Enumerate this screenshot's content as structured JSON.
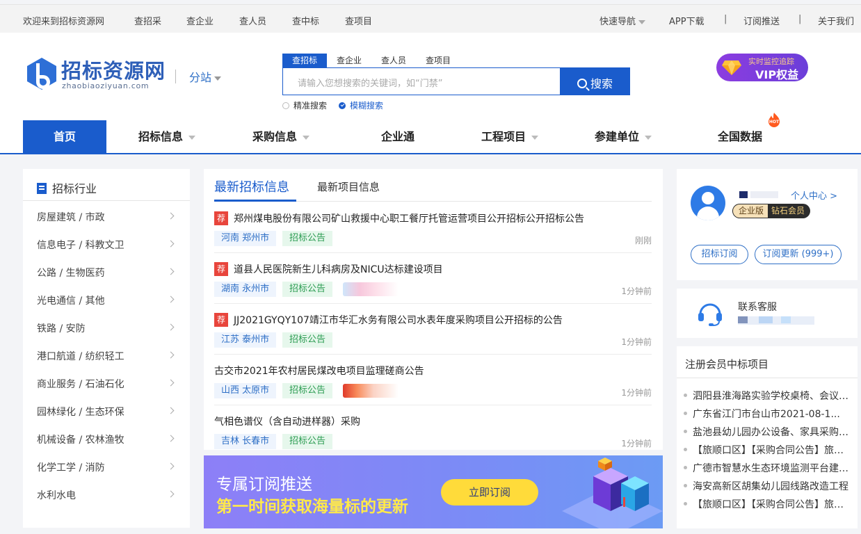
{
  "topbar": {
    "welcome": "欢迎来到招标资源网",
    "links": [
      "查招采",
      "查企业",
      "查人员",
      "查中标",
      "查项目"
    ],
    "quick_nav": "快速导航",
    "app_download": "APP下载",
    "subscribe_push": "订阅推送",
    "about_us": "关于我们",
    "separator": "|"
  },
  "header": {
    "logo_text": "招标资源网",
    "logo_domain": "zhaobiaoziyuan.com",
    "substation": "分站",
    "search_tabs": [
      "查招标",
      "查企业",
      "查人员",
      "查项目"
    ],
    "search_placeholder": "请输入您想搜索的关键词，如“门禁”",
    "search_button": "搜索",
    "search_options": [
      "精准搜索",
      "模糊搜索"
    ],
    "vip_small": "实时监控追踪",
    "vip_big": "VIP权益"
  },
  "nav": {
    "items": [
      "首页",
      "招标信息",
      "采购信息",
      "企业通",
      "工程项目",
      "参建单位",
      "全国数据"
    ],
    "hot_label": "HOT"
  },
  "sidebar": {
    "title": "招标行业",
    "items": [
      "房屋建筑 / 市政",
      "信息电子 / 科教文卫",
      "公路 / 生物医药",
      "光电通信 / 其他",
      "铁路 / 安防",
      "港口航道 / 纺织轻工",
      "商业服务 / 石油石化",
      "园林绿化 / 生态环保",
      "机械设备 / 农林渔牧",
      "化学工学 / 消防",
      "水利水电"
    ]
  },
  "center": {
    "tab_active": "最新招标信息",
    "tab_other": "最新项目信息",
    "rec_label": "荐",
    "rows": [
      {
        "title": "郑州煤电股份有限公司矿山救援中心职工餐厅托管运营项目公开招标公开招标公告",
        "location": "河南 郑州市",
        "type": "招标公告",
        "time": "刚刚"
      },
      {
        "title": "道县人民医院新生儿科病房及NICU达标建设项目",
        "location": "湖南 永州市",
        "type": "招标公告",
        "time": "1分钟前"
      },
      {
        "title": "JJ2021GYQY107靖江市华汇水务有限公司水表年度采购项目公开招标的公告",
        "location": "江苏 泰州市",
        "type": "招标公告",
        "time": "1分钟前"
      },
      {
        "title": "古交市2021年农村居民煤改电项目监理磋商公告",
        "location": "山西 太原市",
        "type": "招标公告",
        "time": "1分钟前"
      },
      {
        "title": "气相色谱仪（含自动进样器）采购",
        "location": "吉林 长春市",
        "type": "招标公告",
        "time": "1分钟前"
      }
    ]
  },
  "banner": {
    "line1": "专属订阅推送",
    "line2": "第一时间获取海量标的更新",
    "button": "立即订阅"
  },
  "user_panel": {
    "personal_center": "个人中心 >",
    "badge_enterprise": "企业版",
    "badge_diamond": "钻石会员",
    "btn_subscribe": "招标订阅",
    "btn_updates": "订阅更新 (999+)"
  },
  "service": {
    "label": "联系客服"
  },
  "winners": {
    "title": "注册会员中标项目",
    "items": [
      "泗阳县淮海路实验学校桌椅、会议室设备采购项目",
      "广东省江门市台山市2021-08-1...",
      "盐池县幼儿园办公设备、家具采购项目",
      "【旅顺口区】【采购合同公告】旅顺口区采购项目",
      "广德市智慧水生态环境监测平台建设项目",
      "海安高新区胡集幼儿园线路改造工程",
      "【旅顺口区】【采购合同公告】旅顺口区采购项目"
    ]
  },
  "colors": {
    "brand_blue": "#1a5ccc",
    "recommend_red": "#e8453c",
    "banner_yellow": "#ffe94a",
    "vip_purple": "#8c3de0"
  }
}
